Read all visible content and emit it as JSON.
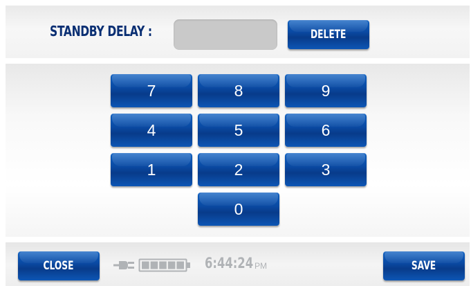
{
  "header": {
    "title": "STANDBY DELAY :",
    "delay_value": "",
    "delete_label": "DELETE"
  },
  "keypad": {
    "keys": [
      "7",
      "8",
      "9",
      "4",
      "5",
      "6",
      "1",
      "2",
      "3",
      "0"
    ]
  },
  "footer": {
    "close_label": "CLOSE",
    "save_label": "SAVE",
    "time": "6:44:24",
    "ampm": "PM",
    "battery_level": 1.0
  },
  "colors": {
    "button_blue": "#0a4aa3",
    "label_navy": "#0a2f73",
    "input_gray": "#c9c9c9",
    "status_gray": "#b0b3b6"
  },
  "icons": {
    "power": "plug-icon",
    "battery": "battery-icon"
  }
}
